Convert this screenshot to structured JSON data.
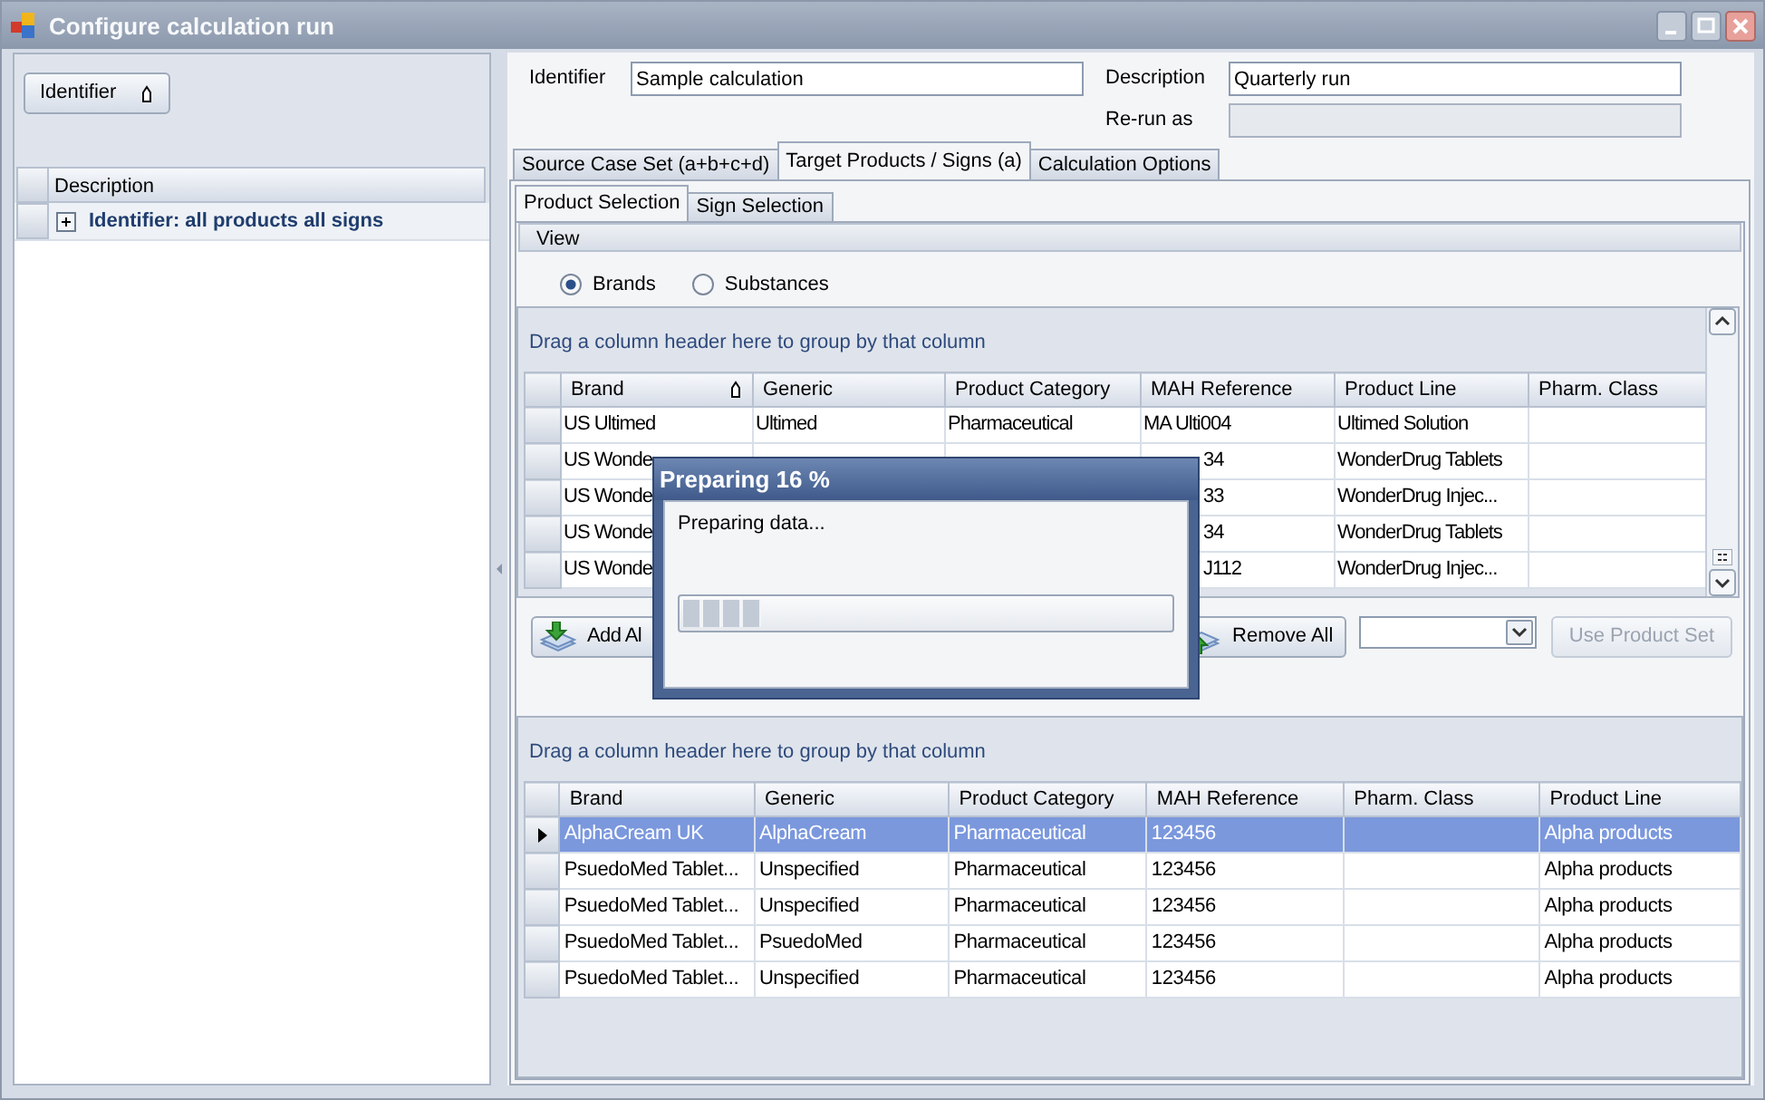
{
  "window": {
    "title": "Configure calculation run"
  },
  "left_panel": {
    "sort_button": {
      "label": "Identifier",
      "sorted": true
    },
    "columns": [
      "Description"
    ],
    "rows": [
      {
        "text": "Identifier: all products all signs",
        "expanded": false
      }
    ]
  },
  "form": {
    "identifier_label": "Identifier",
    "identifier": "Sample calculation",
    "description_label": "Description",
    "description": "Quarterly run",
    "rerun_label": "Re-run as",
    "rerun_disabled": true
  },
  "tabs": [
    {
      "label": "Source Case Set (a+b+c+d)",
      "selected": false
    },
    {
      "label": "Target Products / Signs (a)",
      "selected": true
    },
    {
      "label": "Calculation Options",
      "selected": false
    }
  ],
  "subtabs": [
    {
      "label": "Product Selection",
      "selected": true
    },
    {
      "label": "Sign Selection",
      "selected": false
    }
  ],
  "view": {
    "header": "View",
    "options": [
      {
        "label": "Brands",
        "selected": true
      },
      {
        "label": "Substances",
        "selected": false
      }
    ]
  },
  "upper_grid": {
    "group_hint": "Drag a column header here to group by that column",
    "columns": [
      {
        "label": "Brand",
        "sorted": true
      },
      {
        "label": "Generic",
        "sorted": false
      },
      {
        "label": "Product Category",
        "sorted": false
      },
      {
        "label": "MAH Reference",
        "sorted": false
      },
      {
        "label": "Product Line",
        "sorted": false
      },
      {
        "label": "Pharm. Class",
        "sorted": false
      }
    ],
    "rows": [
      {
        "cells": [
          "US Ultimed",
          "Ultimed",
          "Pharmaceutical",
          "MA Ulti004",
          "Ultimed Solution",
          ""
        ],
        "selected": false
      },
      {
        "cells": [
          "US Wonde",
          "",
          "",
          "34",
          "WonderDrug Tablets",
          ""
        ],
        "selected": false
      },
      {
        "cells": [
          "US Wonde",
          "",
          "",
          "33",
          "WonderDrug Injec...",
          ""
        ],
        "selected": false
      },
      {
        "cells": [
          "US Wonde",
          "",
          "",
          "34",
          "WonderDrug Tablets",
          ""
        ],
        "selected": false
      },
      {
        "cells": [
          "US Wonde",
          "",
          "",
          "J112",
          "WonderDrug Injec...",
          ""
        ],
        "selected": false
      }
    ]
  },
  "buttons": [
    {
      "label": "Add Al",
      "kind": "add",
      "disabled": false
    },
    {
      "label": "Remove All",
      "kind": "remove",
      "disabled": false
    },
    {
      "kind": "dropdown"
    },
    {
      "label": "Use Product Set",
      "kind": "plain",
      "disabled": true
    }
  ],
  "lower_grid": {
    "group_hint": "Drag a column header here to group by that column",
    "columns": [
      {
        "label": "Brand",
        "sorted": false
      },
      {
        "label": "Generic",
        "sorted": false
      },
      {
        "label": "Product Category",
        "sorted": false
      },
      {
        "label": "MAH Reference",
        "sorted": false
      },
      {
        "label": "Pharm. Class",
        "sorted": false
      },
      {
        "label": "Product Line",
        "sorted": false
      }
    ],
    "rows": [
      {
        "cells": [
          "AlphaCream UK",
          "AlphaCream",
          "Pharmaceutical",
          "123456",
          "",
          "Alpha products"
        ],
        "selected": true
      },
      {
        "cells": [
          "PsuedoMed Tablet...",
          "Unspecified",
          "Pharmaceutical",
          "123456",
          "",
          "Alpha products"
        ],
        "selected": false
      },
      {
        "cells": [
          "PsuedoMed Tablet...",
          "Unspecified",
          "Pharmaceutical",
          "123456",
          "",
          "Alpha products"
        ],
        "selected": false
      },
      {
        "cells": [
          "PsuedoMed Tablet...",
          "PsuedoMed",
          "Pharmaceutical",
          "123456",
          "",
          "Alpha products"
        ],
        "selected": false
      },
      {
        "cells": [
          "PsuedoMed Tablet...",
          "Unspecified",
          "Pharmaceutical",
          "123456",
          "",
          "Alpha products"
        ],
        "selected": false
      }
    ]
  },
  "dialog": {
    "title": "Preparing 16 %",
    "message": "Preparing data...",
    "level": 0.16
  }
}
